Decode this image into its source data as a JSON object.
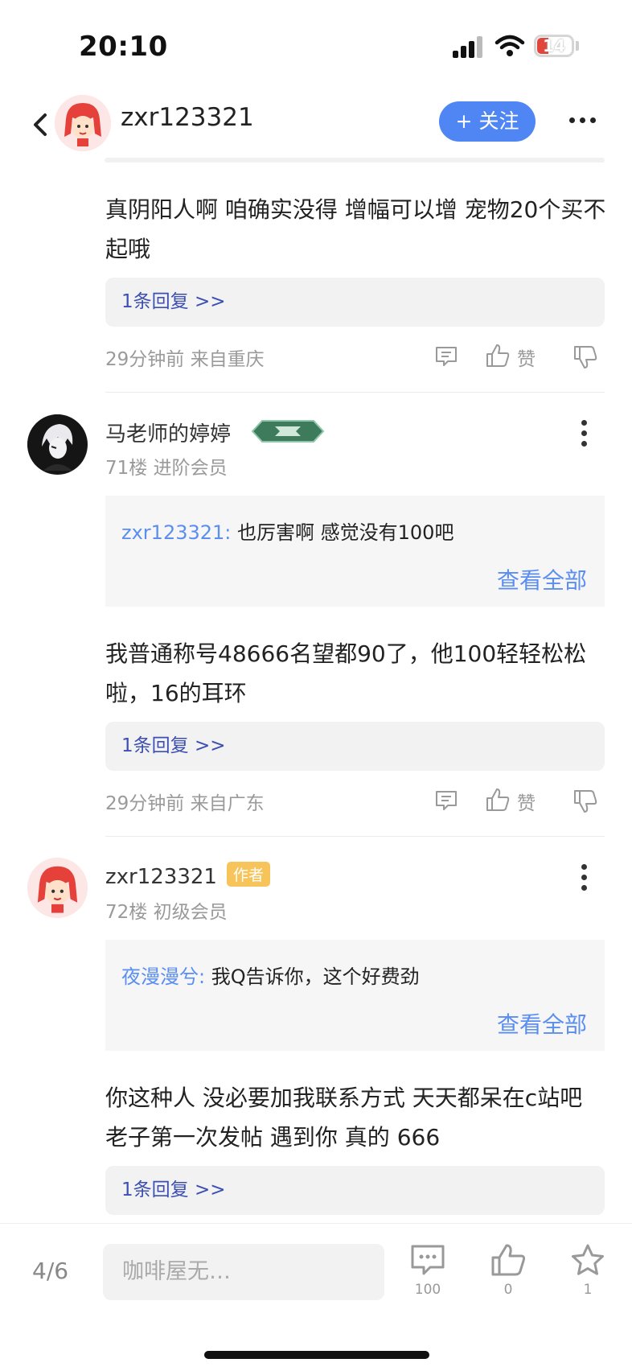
{
  "status_bar": {
    "time": "20:10",
    "battery": "14"
  },
  "header": {
    "username": "zxr123321",
    "follow_label": "+ 关注"
  },
  "comments": [
    {
      "text": "真阴阳人啊  咱确实没得 增幅可以增 宠物20个买不起哦",
      "reply_label": "1条回复 >>",
      "meta": "29分钟前 来自重庆",
      "like_label": "赞"
    },
    {
      "username": "马老师的婷婷",
      "level_badge": "",
      "floor": "71楼 进阶会员",
      "quote_user": "zxr123321:",
      "quote_text": " 也厉害啊 感觉没有100吧",
      "view_all": "查看全部",
      "text": "我普通称号48666名望都90了，他100轻轻松松啦，16的耳环",
      "reply_label": "1条回复 >>",
      "meta": "29分钟前 来自广东",
      "like_label": "赞"
    },
    {
      "username": "zxr123321",
      "author_badge": "作者",
      "floor": "72楼 初级会员",
      "quote_user": "夜漫漫兮:",
      "quote_text": " 我Q告诉你，这个好费劲",
      "view_all": "查看全部",
      "text": "你这种人 没必要加我联系方式  天天都呆在c站吧  老子第一次发帖 遇到你 真的 666",
      "reply_label": "1条回复 >>"
    }
  ],
  "bottom_bar": {
    "page": "4/6",
    "input_placeholder": "咖啡屋无…",
    "comment_count": "100",
    "like_count": "0",
    "star_count": "1"
  }
}
